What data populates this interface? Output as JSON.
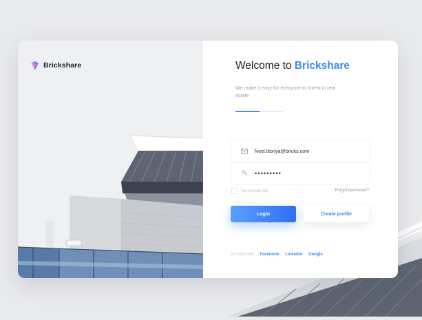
{
  "brand": {
    "name": "Brickshare"
  },
  "welcome": {
    "title_prefix": "Welcome to ",
    "title_accent": "Brickshare",
    "subtitle": "We make it easy for everyone to invest in real estate",
    "progress_fraction": 0.5
  },
  "form": {
    "email_value": "Neel.litoriya@bricks.com",
    "password_value": "•••••••••",
    "remember_label": "Remember me",
    "forgot_label": "Forgot password?",
    "login_label": "Login",
    "create_label": "Create profile"
  },
  "social": {
    "prefix": "Or login with",
    "providers": [
      "Facebook",
      "Linkedin",
      "Google"
    ]
  },
  "colors": {
    "accent": "#3f86f7",
    "button_gradient_start": "#5aa0ff",
    "button_gradient_end": "#2e6ff2",
    "text_dark": "#1b1d23",
    "muted": "#9ea3ab"
  },
  "icons": [
    "brickshare-logo-icon",
    "mail-icon",
    "key-icon"
  ]
}
